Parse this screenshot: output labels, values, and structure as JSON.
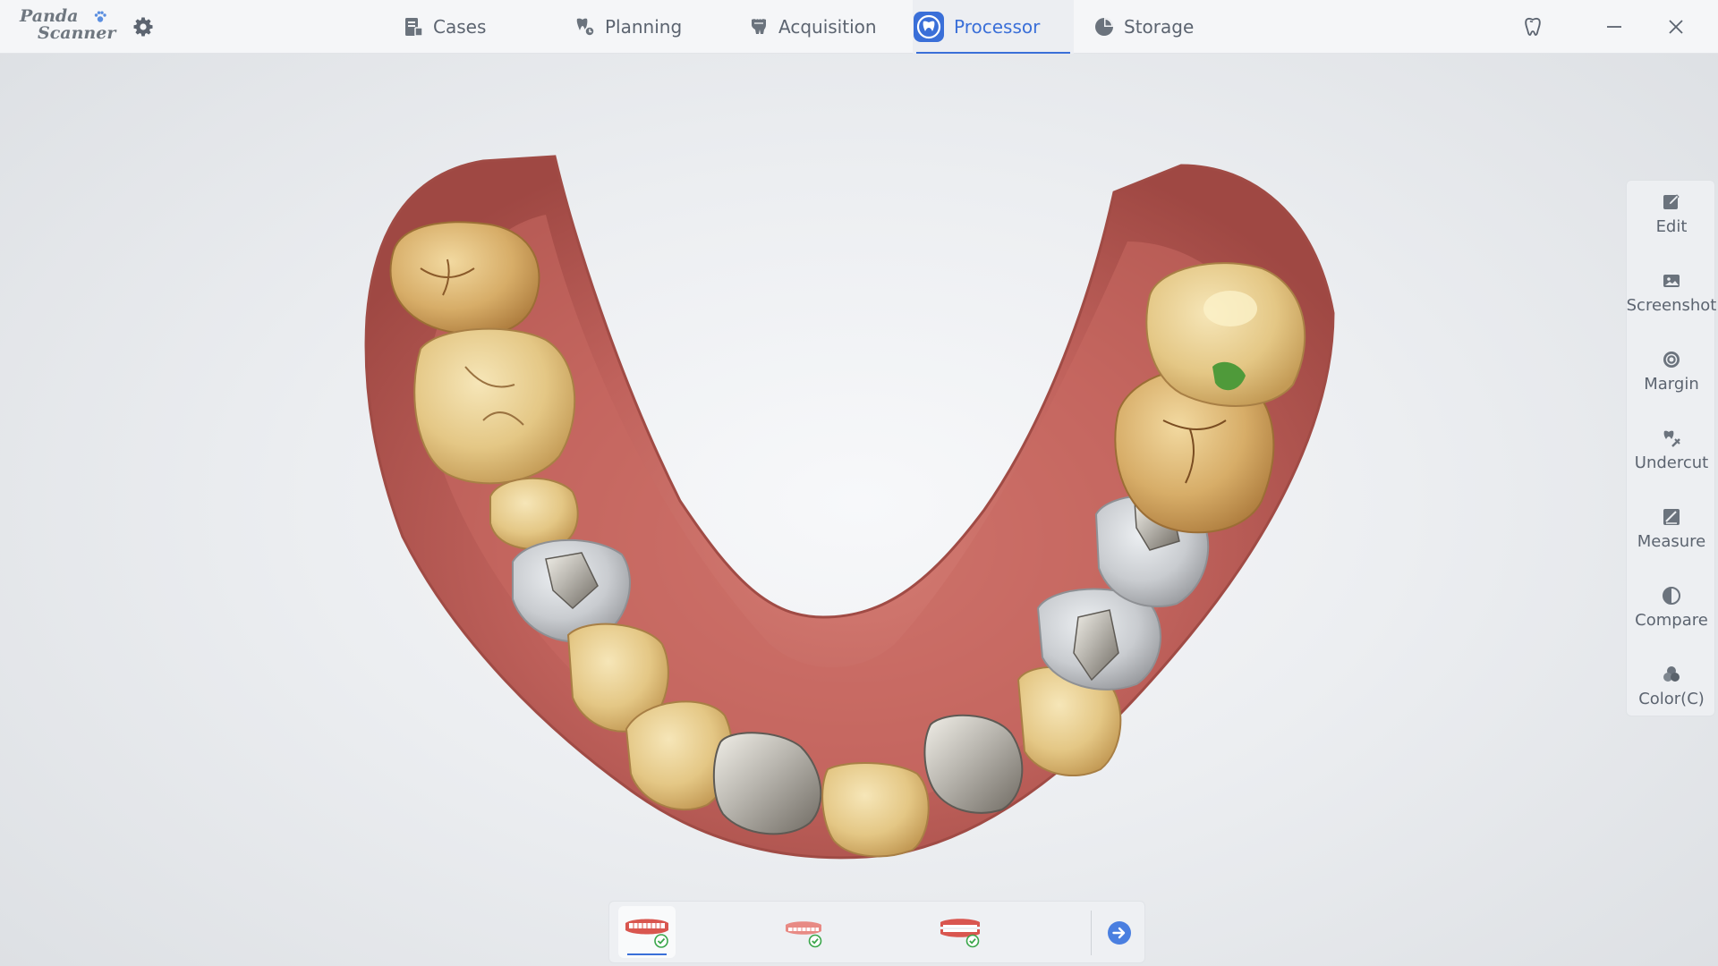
{
  "app": {
    "logo_line1": "Panda",
    "logo_line2": "Scanner"
  },
  "tabs": [
    {
      "label": "Cases",
      "icon": "cases-icon",
      "active": false
    },
    {
      "label": "Planning",
      "icon": "planning-icon",
      "active": false
    },
    {
      "label": "Acquisition",
      "icon": "acquisition-icon",
      "active": false
    },
    {
      "label": "Processor",
      "icon": "processor-icon",
      "active": true
    },
    {
      "label": "Storage",
      "icon": "storage-icon",
      "active": false
    }
  ],
  "tools": [
    {
      "label": "Edit",
      "icon": "edit-icon"
    },
    {
      "label": "Screenshot",
      "icon": "screenshot-icon"
    },
    {
      "label": "Margin",
      "icon": "margin-icon"
    },
    {
      "label": "Undercut",
      "icon": "undercut-icon"
    },
    {
      "label": "Measure",
      "icon": "measure-icon"
    },
    {
      "label": "Compare",
      "icon": "compare-icon"
    },
    {
      "label": "Color(C)",
      "icon": "color-icon"
    }
  ],
  "bottom": {
    "jaws": [
      {
        "icon": "lower-jaw-icon",
        "checked": true,
        "active": true
      },
      {
        "icon": "upper-jaw-icon",
        "checked": true,
        "active": false
      },
      {
        "icon": "bite-icon",
        "checked": true,
        "active": false
      }
    ],
    "next_icon": "arrow-right-icon"
  },
  "colors": {
    "accent": "#3a6fd8",
    "text": "#5c6470",
    "check": "#3aa64a",
    "gum": "#c0625c",
    "tooth": "#e6cf8e",
    "metal": "#b8b5ae"
  }
}
